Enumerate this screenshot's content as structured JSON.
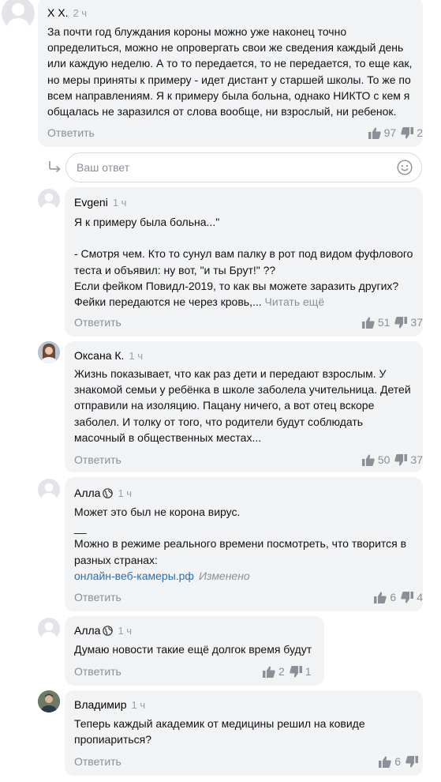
{
  "comments": [
    {
      "author": "Х Х.",
      "time": "2 ч",
      "lines": [
        "За почти год блуждания короны можно уже наконец точно",
        "определиться, можно не опровергать свои же сведения каждый день",
        "или каждую неделю. А то то передается, то не передается, то еще как,",
        "но меры приняты к примеру - идет дистант у старшей школы. То же по",
        "всем направлениям. Я к примеру была больна, однако НИКТО с кем я",
        "общалась не заразился от слова вообще, ни взрослый, ни ребенок."
      ],
      "reply_label": "Ответить",
      "likes": "97",
      "dislikes": "2"
    },
    {
      "author": "Evgeni",
      "time": "1 ч",
      "lines": [
        "Я к примеру была больна...\"",
        "",
        "- Смотря чем. Кто то сунул вам палку в рот под видом фуфлового",
        "теста и объявил: ну вот, \"и ты Брут!\" ??",
        "Если фейком Повидл-2019, то как вы можете заразить других?",
        "Фейки передаются не через кровь,..."
      ],
      "read_more": "Читать ещё",
      "reply_label": "Ответить",
      "likes": "51",
      "dislikes": "37"
    },
    {
      "author": "Оксана К.",
      "time": "1 ч",
      "lines": [
        "Жизнь показывает, что как раз дети и передают взрослым. У",
        "знакомой семьи у ребёнка в школе заболела учительница. Детей",
        "отправили на изоляцию. Пацану ничего, а вот отец вскоре",
        "заболел. И толку от того, что родители будут соблюдать",
        "масочный в общественных местах..."
      ],
      "reply_label": "Ответить",
      "likes": "50",
      "dislikes": "37"
    },
    {
      "author": "Алла",
      "time": "1 ч",
      "lines": [
        "Может это был не корона вирус.",
        "__",
        "Можно в режиме реального времени посмотреть, что творится в",
        "разных странах:"
      ],
      "link": "онлайн-веб-камеры.рф",
      "edited": "Изменено",
      "reply_label": "Ответить",
      "likes": "6",
      "dislikes": "4"
    },
    {
      "author": "Алла",
      "time": "1 ч",
      "lines": [
        "Думаю новости такие ещё долгок время будут"
      ],
      "reply_label": "Ответить",
      "likes": "2",
      "dislikes": "1"
    },
    {
      "author": "Владимир",
      "time": "1 ч",
      "lines": [
        "Теперь каждый академик от медицины решил на ковиде",
        "пропиариться?"
      ],
      "reply_label": "Ответить",
      "likes": "6",
      "dislikes": ""
    }
  ],
  "reply_box": {
    "placeholder": "Ваш ответ"
  },
  "colors": {
    "bubble": "#f2f3f5",
    "muted": "#8a8f98",
    "link": "#2a6fb0"
  },
  "icons": [
    "user-avatar-icon",
    "reply-arrow-icon",
    "smiley-icon",
    "thumbs-up-icon",
    "thumbs-down-icon",
    "globe-icon"
  ]
}
